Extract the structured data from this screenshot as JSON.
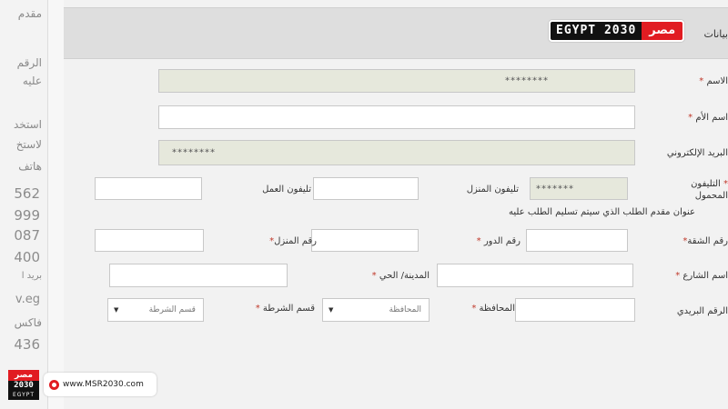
{
  "left_strip": {
    "texts": [
      "مقدم",
      "الرقم",
      "عليه",
      "استخد",
      "لاستخ",
      "هاتف",
      "562",
      "999",
      "087",
      "400",
      "بريد ا",
      "v.eg",
      "فاكس",
      "436"
    ]
  },
  "header": {
    "title": "بيانات"
  },
  "form": {
    "name_label": "الاسم",
    "name_value": "********",
    "mother_label": "اسم الأم",
    "email_label": "البريد الإلكتروني",
    "email_value": "********",
    "mobile_label": "التليفون المحمول",
    "home_phone_label": "تليفون المنزل",
    "home_phone_value": "*******",
    "work_phone_label": "تليفون العمل",
    "address_note": "عنوان مقدم الطلب الذي سيتم تسليم الطلب عليه",
    "apartment_label": "رقم الشقة",
    "floor_label": "رقم الدور",
    "house_label": "رقم المنزل",
    "street_label": "اسم الشارع",
    "city_label": "المدينة/ الحي",
    "postal_label": "الرقم البريدي",
    "governorate_label": "المحافظة",
    "governorate_select": "المحافظة",
    "police_label": "قسم الشرطة",
    "police_select": "قسم الشرطة",
    "required_mark": "*"
  },
  "branding": {
    "top_logo_en": "EGYPT 2030",
    "top_logo_ar": "مصر",
    "bottom_logo_ar": "مصر",
    "bottom_logo_num": "2030",
    "bottom_logo_en": "EGYPT",
    "url": "www.MSR2030.com"
  },
  "colors": {
    "brand_red": "#e11c22",
    "brand_black": "#111111"
  }
}
